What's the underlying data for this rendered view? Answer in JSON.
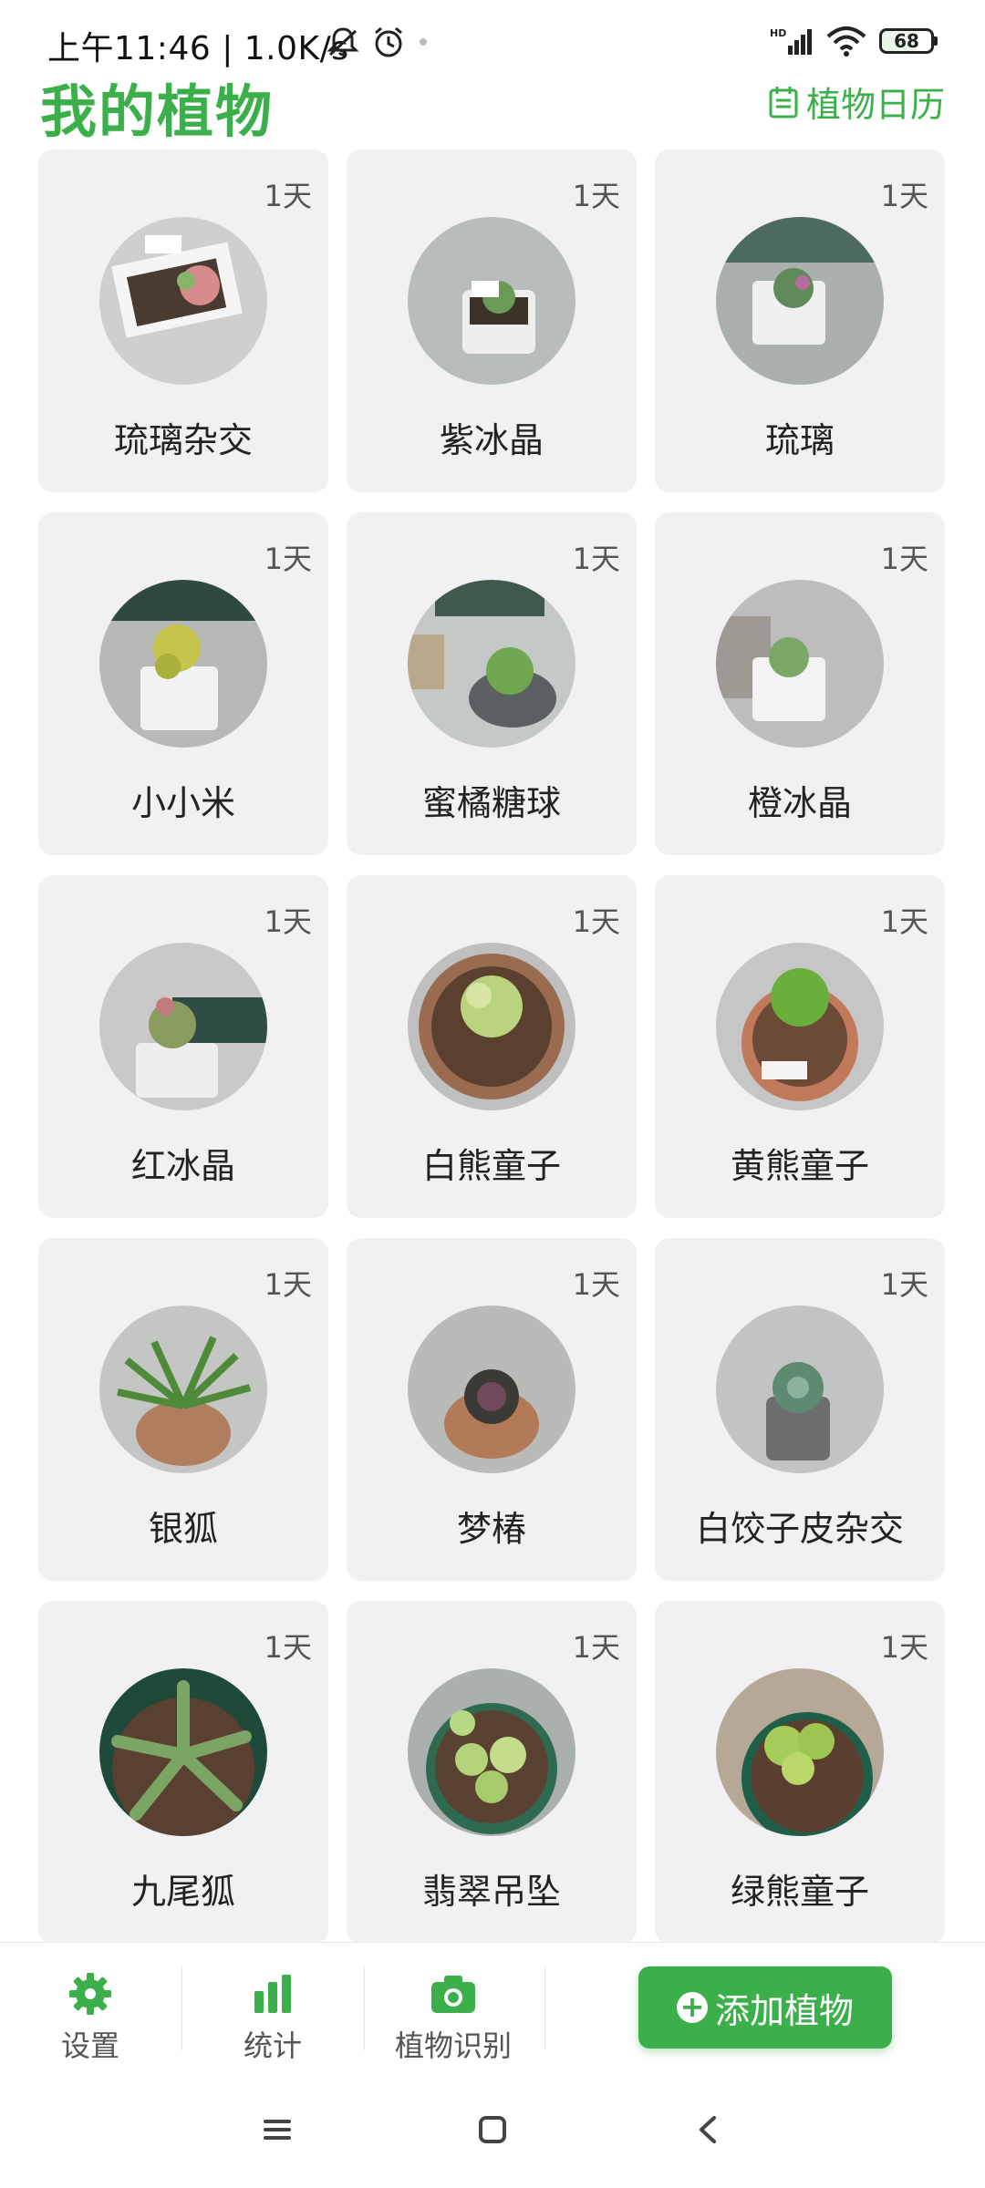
{
  "status_bar": {
    "time": "上午11:46 | 1.0K/s",
    "battery": "68",
    "network": "HD"
  },
  "header": {
    "title": "我的植物",
    "calendar_label": "植物日历"
  },
  "plants": [
    {
      "name": "琉璃杂交",
      "days": "1天"
    },
    {
      "name": "紫冰晶",
      "days": "1天"
    },
    {
      "name": "琉璃",
      "days": "1天"
    },
    {
      "name": "小小米",
      "days": "1天"
    },
    {
      "name": "蜜橘糖球",
      "days": "1天"
    },
    {
      "name": "橙冰晶",
      "days": "1天"
    },
    {
      "name": "红冰晶",
      "days": "1天"
    },
    {
      "name": "白熊童子",
      "days": "1天"
    },
    {
      "name": "黄熊童子",
      "days": "1天"
    },
    {
      "name": "银狐",
      "days": "1天"
    },
    {
      "name": "梦椿",
      "days": "1天"
    },
    {
      "name": "白饺子皮杂交",
      "days": "1天"
    },
    {
      "name": "九尾狐",
      "days": "1天"
    },
    {
      "name": "翡翠吊坠",
      "days": "1天"
    },
    {
      "name": "绿熊童子",
      "days": "1天"
    }
  ],
  "bottom_nav": {
    "settings": "设置",
    "stats": "统计",
    "identify": "植物识别",
    "add": "添加植物"
  },
  "colors": {
    "accent": "#3bb04a",
    "card_bg": "#f1f1f4"
  }
}
